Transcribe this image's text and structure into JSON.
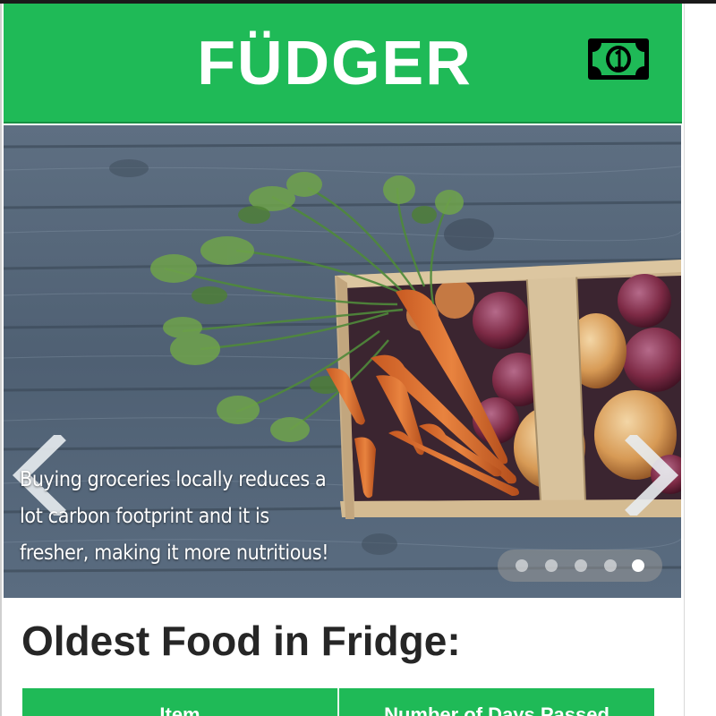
{
  "header": {
    "brand": "FÜDGER",
    "money_icon": "dollar-bill-icon",
    "bar_color": "#1fba57"
  },
  "carousel": {
    "image": "vegetable-basket-on-wood-image",
    "caption_lines": [
      "Buying groceries locally reduces a",
      "lot carbon footprint and it is",
      "fresher, making it more nutritious!"
    ],
    "prev_icon": "chevron-left-icon",
    "next_icon": "chevron-right-icon",
    "slide_count": 5,
    "active_slide": 5
  },
  "main": {
    "title": "Oldest Food in Fridge:",
    "table_headers": [
      "Item",
      "Number of Days Passed"
    ]
  }
}
